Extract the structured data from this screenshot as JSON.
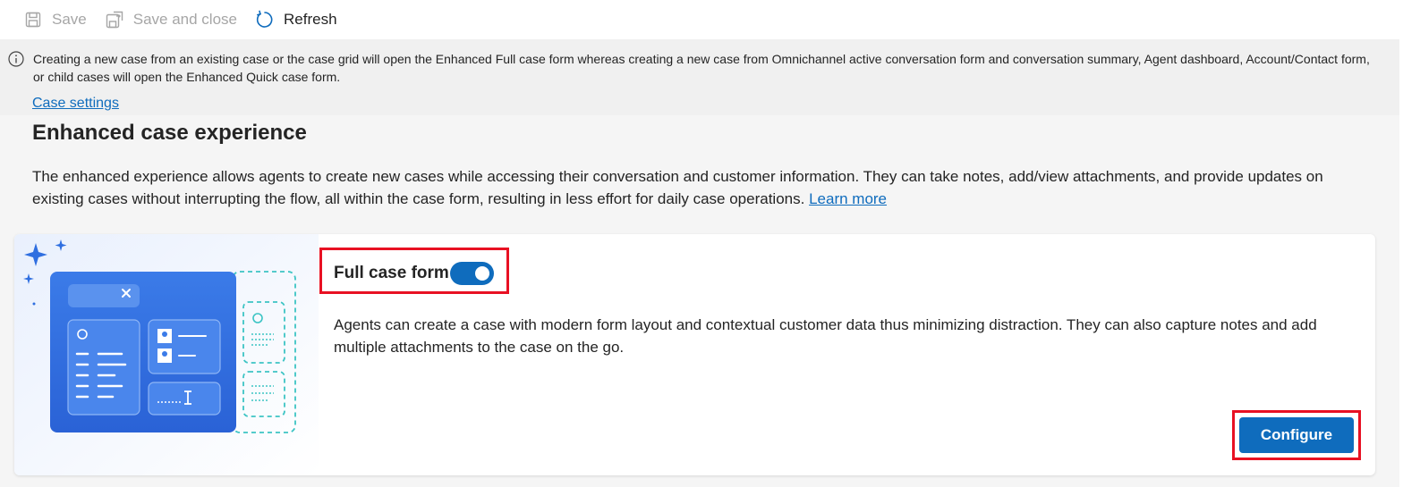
{
  "toolbar": {
    "save_label": "Save",
    "save_close_label": "Save and close",
    "refresh_label": "Refresh"
  },
  "notice": {
    "text": "Creating a new case from an existing case or the case grid will open the Enhanced Full case form whereas creating a new case from Omnichannel active conversation form and conversation summary, Agent dashboard, Account/Contact form, or child cases will open the Enhanced Quick case form."
  },
  "breadcrumb": {
    "case_settings": "Case settings"
  },
  "section": {
    "title": "Enhanced case experience",
    "description": "The enhanced experience allows agents to create new cases while accessing their conversation and customer information. They can take notes, add/view attachments, and provide updates on existing cases without interrupting the flow, all within the case form, resulting in less effort for daily case operations.",
    "learn_more": "Learn more"
  },
  "card": {
    "toggle_label": "Full case form",
    "toggle_state": "on",
    "description": "Agents can create a case with modern form layout and contextual customer data thus minimizing distraction. They can also capture notes and add multiple attachments to the case on the go.",
    "configure_label": "Configure"
  },
  "colors": {
    "accent": "#0f6cbd",
    "highlight": "#e81123",
    "illustration_blue": "#2f6fe0",
    "illustration_teal": "#3cc4c4"
  }
}
